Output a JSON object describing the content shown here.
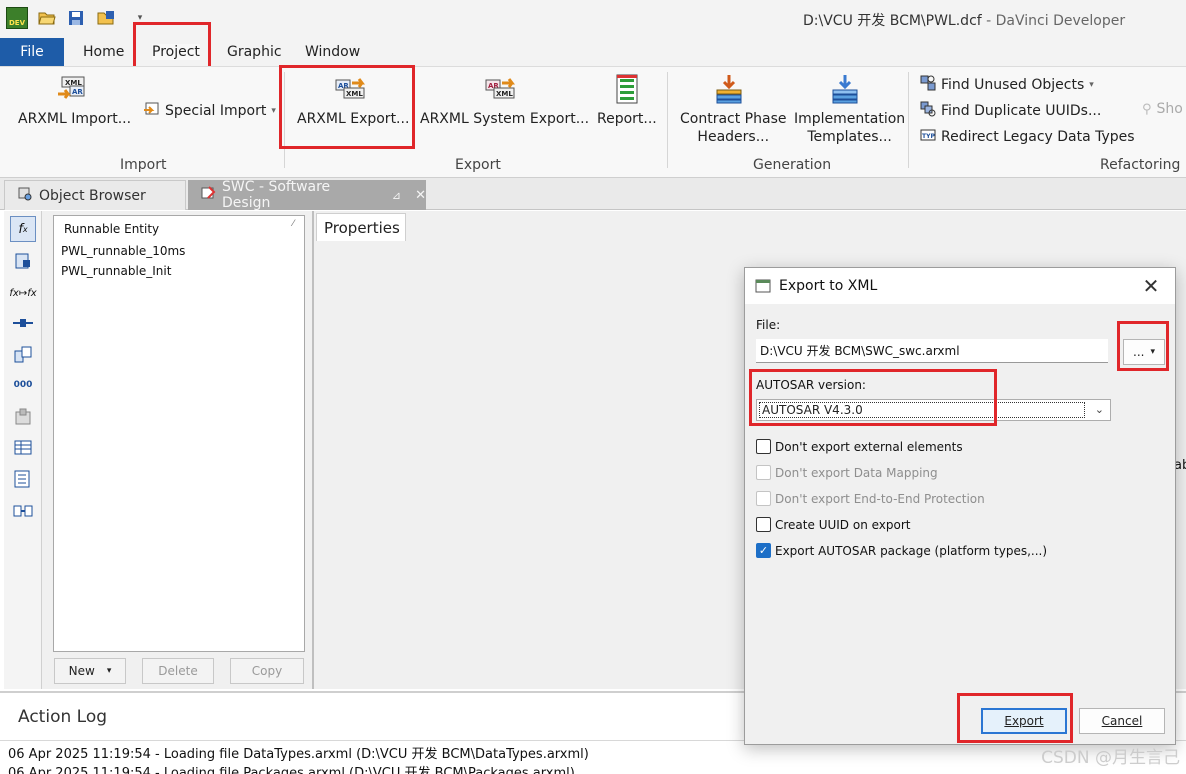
{
  "window": {
    "title_path": "D:\\VCU 开发 BCM\\PWL.dcf",
    "title_app": " - DaVinci Developer",
    "logo_text": "DEV"
  },
  "ribbon": {
    "tabs": [
      "File",
      "Home",
      "Project",
      "Graphic",
      "Window"
    ],
    "active_tab": "Project",
    "groups": {
      "import": {
        "label": "Import",
        "arxml_import": "ARXML Import...",
        "special_import": "Special Import"
      },
      "export": {
        "label": "Export",
        "arxml_export": "ARXML Export...",
        "arxml_system_export": "ARXML System Export...",
        "report": "Report..."
      },
      "generation": {
        "label": "Generation",
        "contract_phase_1": "Contract Phase",
        "contract_phase_2": "Headers...",
        "impl_templates_1": "Implementation",
        "impl_templates_2": "Templates..."
      },
      "refactoring": {
        "label": "Refactoring",
        "find_unused": "Find Unused Objects",
        "find_duplicate": "Find Duplicate UUIDs...",
        "redirect_legacy": "Redirect Legacy Data Types",
        "show_cut": "Sho"
      }
    }
  },
  "doc_tabs": {
    "object_browser": "Object Browser",
    "swc": "SWC - Software Design"
  },
  "entity_panel": {
    "header": "Runnable Entity",
    "items": [
      "PWL_runnable_10ms",
      "PWL_runnable_Init"
    ],
    "buttons": {
      "new": "New",
      "delete": "Delete",
      "copy": "Copy"
    }
  },
  "properties": {
    "tab": "Properties",
    "cut_text": "ab"
  },
  "action_log": {
    "title": "Action Log",
    "lines": [
      "06 Apr 2025 11:19:54 - Loading file DataTypes.arxml (D:\\VCU 开发 BCM\\DataTypes.arxml)",
      "06 Apr 2025 11:19:54 - Loading file Packages.arxml (D:\\VCU 开发 BCM\\Packages.arxml)"
    ]
  },
  "dialog": {
    "title": "Export to XML",
    "file_label": "File:",
    "file_value": "D:\\VCU 开发 BCM\\SWC_swc.arxml",
    "browse_label": "...",
    "autosar_label": "AUTOSAR version:",
    "autosar_value": "AUTOSAR V4.3.0",
    "options": [
      {
        "label": "Don't export external elements",
        "checked": false,
        "enabled": true
      },
      {
        "label": "Don't export Data Mapping",
        "checked": false,
        "enabled": false
      },
      {
        "label": "Don't export End-to-End Protection",
        "checked": false,
        "enabled": false
      },
      {
        "label": "Create UUID on export",
        "checked": false,
        "enabled": true
      },
      {
        "label": "Export AUTOSAR package (platform types,...)",
        "checked": true,
        "enabled": true
      }
    ],
    "export_button": "Export",
    "cancel_button": "Cancel"
  },
  "watermark": "CSDN @月生言己",
  "colors": {
    "file_tab": "#1e5ca8",
    "highlight": "#e0262a",
    "primary_button_border": "#2b76d3",
    "checkbox_on": "#1d6fc7"
  },
  "icons": [
    "app-logo-icon",
    "open-folder-icon",
    "save-icon",
    "save-all-icon",
    "quick-access-dropdown-icon",
    "xml-import-icon",
    "special-import-icon",
    "arxml-export-icon",
    "arxml-system-export-icon",
    "report-icon",
    "contract-phase-icon",
    "implementation-templates-icon",
    "find-unused-icon",
    "find-duplicate-icon",
    "redirect-legacy-icon",
    "object-browser-icon",
    "swc-icon",
    "pin-icon",
    "close-icon"
  ]
}
